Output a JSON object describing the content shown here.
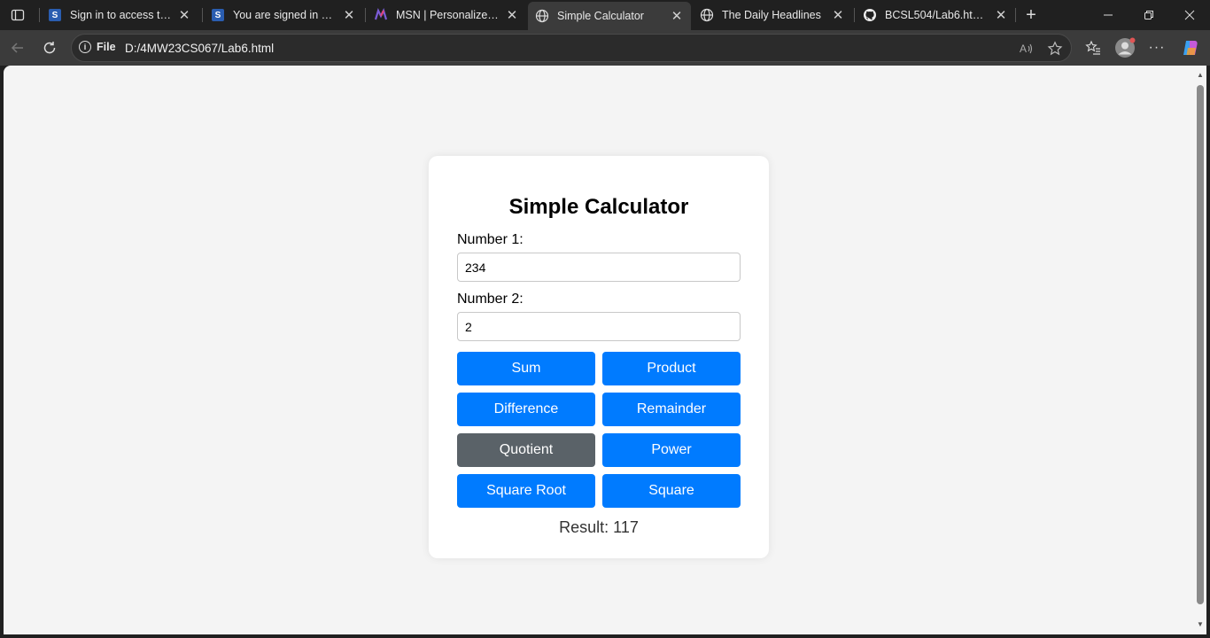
{
  "browser": {
    "tabs": [
      {
        "title": "Sign in to access this n",
        "icon": "s-logo-icon"
      },
      {
        "title": "You are signed in as 23",
        "icon": "s-logo-icon"
      },
      {
        "title": "MSN | Personalized Ne",
        "icon": "msn-icon"
      },
      {
        "title": "Simple Calculator",
        "icon": "globe-icon",
        "active": true
      },
      {
        "title": "The Daily Headlines",
        "icon": "globe-icon"
      },
      {
        "title": "BCSL504/Lab6.html at",
        "icon": "github-icon"
      }
    ],
    "address": {
      "scheme_label": "File",
      "url": "D:/4MW23CS067/Lab6.html"
    }
  },
  "calculator": {
    "title": "Simple Calculator",
    "number1_label": "Number 1:",
    "number1_value": "234",
    "number2_label": "Number 2:",
    "number2_value": "2",
    "buttons": {
      "sum": "Sum",
      "product": "Product",
      "difference": "Difference",
      "remainder": "Remainder",
      "quotient": "Quotient",
      "power": "Power",
      "square_root": "Square Root",
      "square": "Square"
    },
    "result": "Result: 117",
    "colors": {
      "button": "#007bff",
      "button_hover": "#5a6268"
    }
  }
}
